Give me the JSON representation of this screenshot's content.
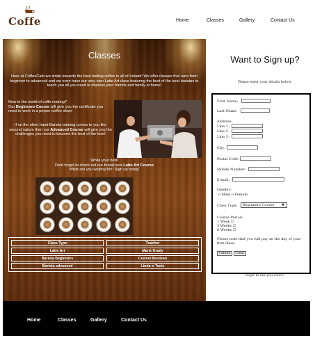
{
  "brand": {
    "name": "Coffe"
  },
  "nav": [
    {
      "label": "Home"
    },
    {
      "label": "Classes"
    },
    {
      "label": "Gallery"
    },
    {
      "label": "Contact Us"
    }
  ],
  "main": {
    "title": "Classes",
    "intro": "Here at CoffeeCafe we stride towards the best tasting coffee in all of Ireland! We offer classes that rane from beginner to advanced and we even have our very own Latte Art class featuring the best of the best baristas to teach you all you need to impress your friends and family at home!",
    "para2_a": "New to the world of coffe making?",
    "para2_b": "Our ",
    "para2_bold": "Beginners Course",
    "para2_c": " will give you the certificate you need to work in a proper coffee shop!",
    "para3_a": "If on the other hand Barista training comes to you like second nature then our ",
    "para3_bold": "Advanced Course",
    "para3_b": " will give you the challenges you need to become the best of the best!",
    "cta_1": "While your here",
    "cta_2a": "Dont forget to check out our brand new ",
    "cta_2bold": "Latte Art Course",
    "cta_3": "What are you waiting for!! Sign up today!",
    "table": {
      "headers": [
        "Class Type",
        "Teacher"
      ],
      "rows": [
        [
          "Latte Art",
          "Marie Grady"
        ],
        [
          "Barista Beginners",
          "Conner Boolean"
        ],
        [
          "Barista advanced",
          "Linda o Toole"
        ]
      ]
    }
  },
  "signup": {
    "title": "Want to Sign up?",
    "subtitle": "Please enter your details below:",
    "first_name": "First Name:",
    "last_name": "Last Name:",
    "address": "Address:",
    "line1": "Line 1 :",
    "line2": "Line 2 :",
    "line3": "Line 3 :",
    "city": "City:",
    "postal": "Postal Code:",
    "mobile": "Mobile Number:",
    "email": "E-mail:",
    "gender": "Gender:",
    "male": "Male",
    "female": "Female",
    "class_type": "Class Type:",
    "class_selected": "Beginners Course",
    "period": "Course Period:",
    "week1": "1 Week",
    "week3": "3 Weeks",
    "week6": "6 Weeks",
    "note": "Please note that you will pay on the day of your first class.",
    "submit": "Submit",
    "clear": "Clear",
    "hope": "Hope to see you soon!!"
  },
  "footer": [
    {
      "label": "Home"
    },
    {
      "label": "Classes"
    },
    {
      "label": "Gallery"
    },
    {
      "label": "Contact Us"
    }
  ]
}
